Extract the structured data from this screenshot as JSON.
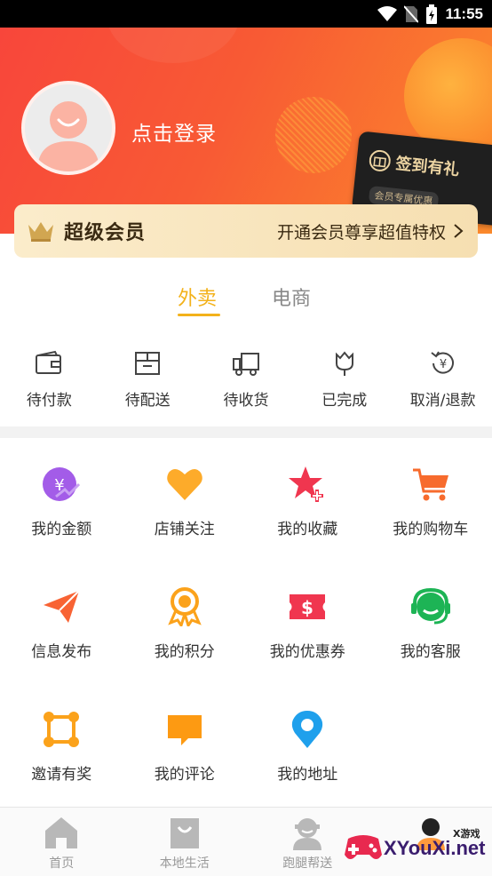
{
  "status_bar": {
    "time": "11:55"
  },
  "header": {
    "login_text": "点击登录",
    "signin_card": {
      "label": "签到有礼",
      "sub": "会员专属优惠"
    }
  },
  "vip": {
    "title": "超级会员",
    "promo": "开通会员尊享超值特权"
  },
  "tabs": [
    {
      "label": "外卖",
      "active": true
    },
    {
      "label": "电商",
      "active": false
    }
  ],
  "orders": [
    {
      "label": "待付款",
      "icon": "wallet-icon"
    },
    {
      "label": "待配送",
      "icon": "package-icon"
    },
    {
      "label": "待收货",
      "icon": "truck-icon"
    },
    {
      "label": "已完成",
      "icon": "flower-icon"
    },
    {
      "label": "取消/退款",
      "icon": "refund-icon"
    }
  ],
  "services": [
    [
      {
        "label": "我的金额",
        "icon": "money-icon",
        "color": "#a35ce8"
      },
      {
        "label": "店铺关注",
        "icon": "heart-icon",
        "color": "#fdab2a"
      },
      {
        "label": "我的收藏",
        "icon": "star-plus-icon",
        "color": "#f0364f"
      },
      {
        "label": "我的购物车",
        "icon": "cart-icon",
        "color": "#f76b2d"
      }
    ],
    [
      {
        "label": "信息发布",
        "icon": "paper-plane-icon",
        "color": "#f86334"
      },
      {
        "label": "我的积分",
        "icon": "medal-icon",
        "color": "#fba21b"
      },
      {
        "label": "我的优惠券",
        "icon": "coupon-icon",
        "color": "#f0364f"
      },
      {
        "label": "我的客服",
        "icon": "headset-icon",
        "color": "#1db455"
      }
    ],
    [
      {
        "label": "邀请有奖",
        "icon": "share-nodes-icon",
        "color": "#fba21b"
      },
      {
        "label": "我的评论",
        "icon": "comment-icon",
        "color": "#fd9a12"
      },
      {
        "label": "我的地址",
        "icon": "location-pin-icon",
        "color": "#1fa0ec"
      }
    ]
  ],
  "bottom_nav": [
    {
      "label": "首页",
      "icon": "home-icon"
    },
    {
      "label": "本地生活",
      "icon": "shopping-bag-icon"
    },
    {
      "label": "跑腿帮送",
      "icon": "courier-icon"
    },
    {
      "label": "",
      "icon": "profile-icon"
    }
  ],
  "watermark": {
    "text": "XYouXi.net",
    "small": "X游戏"
  },
  "colors": {
    "brand": "#f85a34",
    "accent": "#f3b21b",
    "vip_bg": "#f6dfb1"
  }
}
